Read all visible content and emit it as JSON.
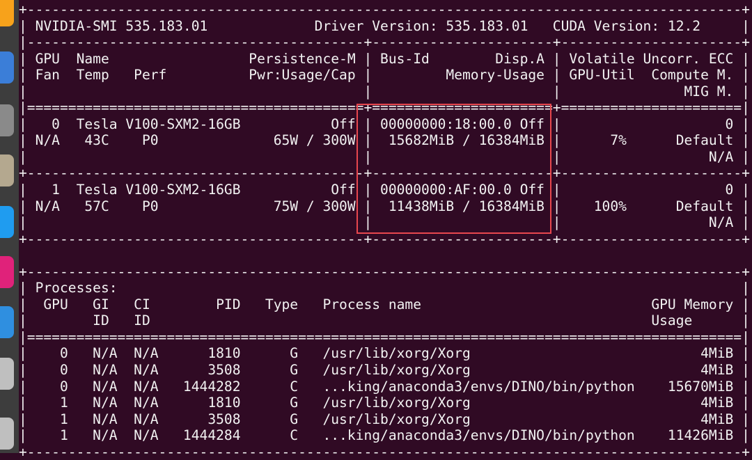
{
  "dock": {
    "icons": [
      {
        "name": "firefox-icon",
        "color": "#f7a21b"
      },
      {
        "name": "thunderbird-icon",
        "color": "#3b7ed8"
      },
      {
        "name": "files-icon",
        "color": "#8a8a8a"
      },
      {
        "name": "archive-icon",
        "color": "#b4a88f"
      },
      {
        "name": "vscode-icon",
        "color": "#1f9cf0"
      },
      {
        "name": "app-icon-pink",
        "color": "#e0227a"
      },
      {
        "name": "app-icon-blue",
        "color": "#2f8fe0"
      },
      {
        "name": "app-icon-grey",
        "color": "#bfbfbf"
      }
    ]
  },
  "highlight": {
    "color": "#e8474e"
  },
  "terminal": {
    "lines": [
      "+---------------------------------------------------------------------------------------+",
      "| NVIDIA-SMI 535.183.01             Driver Version: 535.183.01   CUDA Version: 12.2     |",
      "|-----------------------------------------+----------------------+----------------------+",
      "| GPU  Name                 Persistence-M | Bus-Id        Disp.A | Volatile Uncorr. ECC |",
      "| Fan  Temp   Perf          Pwr:Usage/Cap |         Memory-Usage | GPU-Util  Compute M. |",
      "|                                         |                      |               MIG M. |",
      "|=========================================+======================+======================|",
      "|   0  Tesla V100-SXM2-16GB           Off | 00000000:18:00.0 Off |                    0 |",
      "| N/A   43C    P0              65W / 300W |  15682MiB / 16384MiB |      7%      Default |",
      "|                                         |                      |                  N/A |",
      "+-----------------------------------------+----------------------+----------------------+",
      "|   1  Tesla V100-SXM2-16GB           Off | 00000000:AF:00.0 Off |                    0 |",
      "| N/A   57C    P0              75W / 300W |  11438MiB / 16384MiB |    100%      Default |",
      "|                                         |                      |                  N/A |",
      "+-----------------------------------------+----------------------+----------------------+",
      "",
      "+---------------------------------------------------------------------------------------+",
      "| Processes:                                                                            |",
      "|  GPU   GI   CI        PID   Type   Process name                            GPU Memory |",
      "|        ID   ID                                                             Usage      |",
      "|=======================================================================================|",
      "|    0   N/A  N/A      1810      G   /usr/lib/xorg/Xorg                            4MiB |",
      "|    0   N/A  N/A      3508      G   /usr/lib/xorg/Xorg                            4MiB |",
      "|    0   N/A  N/A   1444282      C   ...king/anaconda3/envs/DINO/bin/python    15670MiB |",
      "|    1   N/A  N/A      1810      G   /usr/lib/xorg/Xorg                            4MiB |",
      "|    1   N/A  N/A      3508      G   /usr/lib/xorg/Xorg                            4MiB |",
      "|    1   N/A  N/A   1444284      C   ...king/anaconda3/envs/DINO/bin/python    11426MiB |",
      "+---------------------------------------------------------------------------------------+"
    ]
  }
}
